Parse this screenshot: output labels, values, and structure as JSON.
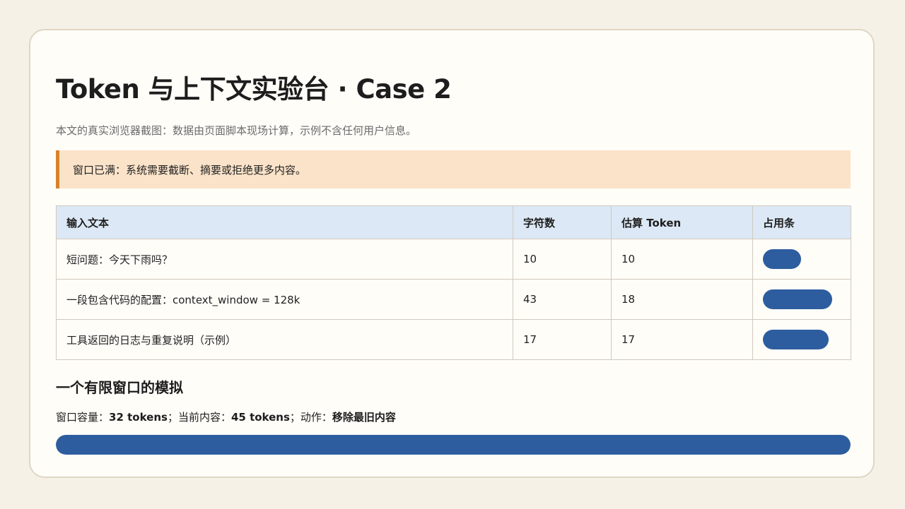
{
  "page": {
    "title": "Token 与上下文实验台 · Case 2",
    "subtitle": "本文的真实浏览器截图：数据由页面脚本现场计算，示例不含任何用户信息。",
    "alert": "窗口已满：系统需要截断、摘要或拒绝更多内容。"
  },
  "colors": {
    "background": "#f6f1e6",
    "card": "#fffdf8",
    "accent_bar": "#2d5d9f",
    "alert_bg": "#fbe3c9",
    "alert_border": "#d9822b",
    "table_header": "#dce8f5"
  },
  "table": {
    "headers": [
      "输入文本",
      "字符数",
      "估算 Token",
      "占用条"
    ],
    "rows": [
      {
        "text": "短问题：今天下雨吗？",
        "chars": "10",
        "tokens": "10",
        "usage_fraction": 0.556
      },
      {
        "text": "一段包含代码的配置：context_window = 128k",
        "chars": "43",
        "tokens": "18",
        "usage_fraction": 1.0
      },
      {
        "text": "工具返回的日志与重复说明（示例）",
        "chars": "17",
        "tokens": "17",
        "usage_fraction": 0.944
      }
    ]
  },
  "simulation": {
    "title": "一个有限窗口的模拟",
    "capacity_label": "窗口容量：",
    "capacity_value": "32 tokens",
    "sep1": "；当前内容：",
    "current_value": "45 tokens",
    "sep2": "；动作：",
    "action_value": "移除最旧内容",
    "fill_fraction": 1.0
  }
}
